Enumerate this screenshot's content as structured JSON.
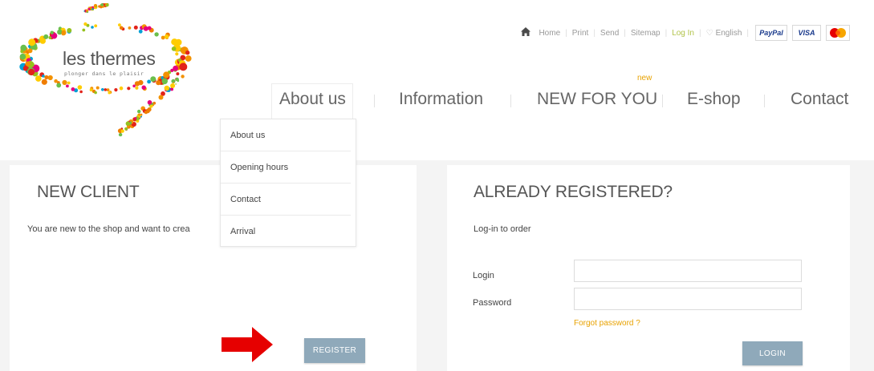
{
  "logo": {
    "title": "les thermes",
    "tagline": "plonger dans le plaisir"
  },
  "topbar": {
    "home": "Home",
    "print": "Print",
    "send": "Send",
    "sitemap": "Sitemap",
    "login": "Log In",
    "language": "English",
    "payment": [
      "PayPal",
      "VISA",
      "MasterCard"
    ]
  },
  "nav": {
    "about": "About us",
    "information": "Information",
    "new_for_you": "NEW FOR YOU",
    "new_tag": "new",
    "eshop": "E-shop",
    "contact": "Contact"
  },
  "dropdown": {
    "items": [
      "About us",
      "Opening hours",
      "Contact",
      "Arrival"
    ]
  },
  "new_client": {
    "title": "NEW CLIENT",
    "text": "You are new to the shop and want to crea",
    "register_label": "REGISTER"
  },
  "registered": {
    "title": "ALREADY REGISTERED?",
    "subtitle": "Log-in to order",
    "login_label": "Login",
    "password_label": "Password",
    "login_value": "",
    "password_value": "",
    "forgot": "Forgot password ?",
    "login_button": "LOGIN"
  },
  "colors": {
    "accent_green": "#b1c34a",
    "accent_orange": "#e8a200",
    "button": "#8fa9ba",
    "arrow": "#e60000"
  }
}
